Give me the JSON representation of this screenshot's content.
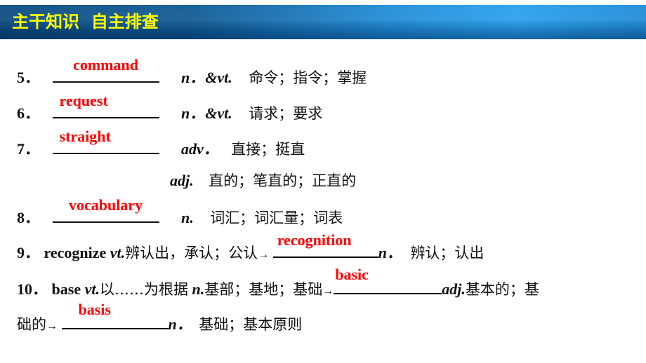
{
  "header": {
    "title": "主干知识  自主排查",
    "title_color": "#ffff00",
    "bar_color": "#1f8bd6"
  },
  "items": [
    {
      "num": "5．",
      "answer": "command",
      "pos": "n．&vt.",
      "meaning": "命令；指令；掌握"
    },
    {
      "num": "6．",
      "answer": "request",
      "pos": "n．&vt.",
      "meaning": "请求；要求"
    },
    {
      "num": "7．",
      "answer": "straight",
      "pos": "adv．",
      "meaning": "直接；挺直",
      "extra_pos": "adj.",
      "extra_meaning": "直的；笔直的；正直的"
    },
    {
      "num": "8．",
      "answer": "vocabulary",
      "pos": "n.",
      "meaning": "词汇；词汇量；词表"
    }
  ],
  "item9": {
    "num": "9．",
    "word": "recognize",
    "pos": "vt.",
    "meaning": "辨认出，承认；公认",
    "arrow": "→",
    "answer": "recognition",
    "answer_pos": "n．",
    "answer_meaning": "辨认；认出"
  },
  "item10": {
    "num": "10．",
    "word": "base",
    "pos1": "vt.",
    "meaning1": "以……为根据",
    "pos2": "n.",
    "meaning2": "基部；基地；基础",
    "arrow": "→",
    "answer1": "basic",
    "answer1_pos": "adj.",
    "answer1_meaning_a": "基本的；基",
    "answer1_meaning_b": "础的",
    "answer2": "basis",
    "answer2_pos": "n．",
    "answer2_meaning": "基础；基本原则"
  },
  "answer_color": "#ff0000"
}
